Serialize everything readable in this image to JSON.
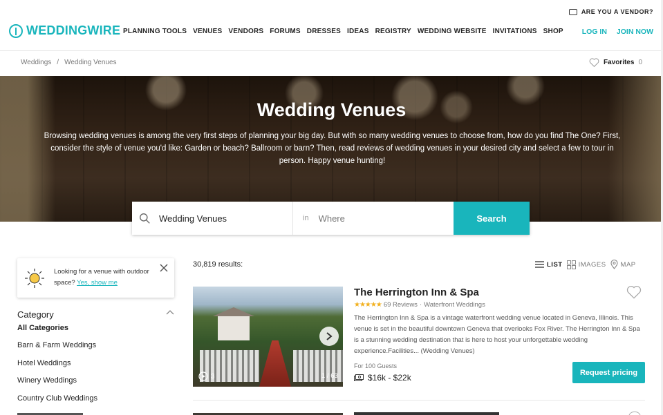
{
  "header": {
    "logo_text": "WEDDINGWIRE",
    "vendor_label": "ARE YOU A VENDOR?",
    "nav": [
      "PLANNING TOOLS",
      "VENUES",
      "VENDORS",
      "FORUMS",
      "DRESSES",
      "IDEAS",
      "REGISTRY",
      "WEDDING WEBSITE",
      "INVITATIONS",
      "SHOP"
    ],
    "login": "LOG IN",
    "join": "JOIN NOW",
    "brand_color": "#19b5bc"
  },
  "breadcrumb": {
    "items": [
      "Weddings",
      "Wedding Venues"
    ],
    "separator": "/"
  },
  "favorites": {
    "label": "Favorites",
    "count": "0"
  },
  "hero": {
    "title": "Wedding Venues",
    "description": "Browsing wedding venues is among the very first steps of planning your big day. But with so many wedding venues to choose from, how do you find The One? First, consider the style of venue you'd like: Garden or beach? Ballroom or barn? Then, read reviews of wedding venues in your desired city and select a few to tour in person. Happy venue hunting!"
  },
  "search": {
    "what_value": "Wedding Venues",
    "in_label": "in",
    "where_placeholder": "Where",
    "button": "Search"
  },
  "promo": {
    "text": "Looking for a venue with outdoor space?",
    "link": "Yes, show me"
  },
  "filters": {
    "title": "Category",
    "items": [
      "All Categories",
      "Barn & Farm Weddings",
      "Hotel Weddings",
      "Winery Weddings",
      "Country Club Weddings"
    ]
  },
  "results": {
    "count": "30,819 results:",
    "views": [
      "LIST",
      "IMAGES",
      "MAP"
    ],
    "active_view": "LIST"
  },
  "listing": {
    "title": "The Herrington Inn & Spa",
    "rating_stars": 5,
    "reviews": "69 Reviews",
    "meta_sep": "·",
    "category": "Waterfront Weddings",
    "description": "The Herrington Inn & Spa is a vintage waterfront wedding venue located in Geneva, Illinois. This venue is set in the beautiful downtown Geneva that overlooks Fox River. The Herrington Inn & Spa is a stunning wedding destination that is here to host your unforgettable wedding experience.Facilities... (Wedding Venues)",
    "guests": "For 100 Guests",
    "price": "$16k - $22k",
    "video_count": "3",
    "photo_counter": "1 / 63",
    "cta": "Request pricing"
  }
}
